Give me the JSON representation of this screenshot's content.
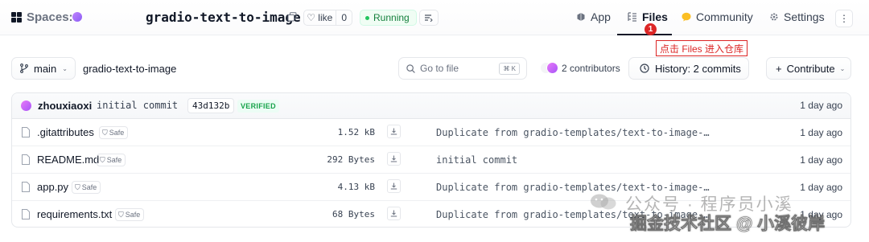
{
  "header": {
    "brand": "Spaces:",
    "repo_name": "gradio-text-to-image",
    "like_label": "like",
    "like_count": "0",
    "status": "Running",
    "nav": {
      "app": "App",
      "files": "Files",
      "community": "Community",
      "settings": "Settings"
    },
    "icons": [
      "spaces-logo-icon",
      "copy-icon",
      "heart-icon",
      "logs-icon",
      "app-icon",
      "files-icon",
      "community-icon",
      "gear-icon",
      "more-icon"
    ]
  },
  "annotation": {
    "number": "1",
    "callout": "点击 Files 进入仓库"
  },
  "toolbar": {
    "branch": "main",
    "path": "gradio-text-to-image",
    "search_placeholder": "Go to file",
    "search_shortcut": "⌘ K",
    "contributors": "2 contributors",
    "history": "History: 2 commits",
    "contribute": "Contribute"
  },
  "last_commit": {
    "author": "zhouxiaoxi",
    "message": "initial commit",
    "hash": "43d132b",
    "verified": "VERIFIED",
    "time": "1 day ago"
  },
  "files": [
    {
      "name": ".gitattributes",
      "safe": "Safe",
      "size": "1.52 kB",
      "commit": "Duplicate from gradio-templates/text-to-image-…",
      "time": "1 day ago"
    },
    {
      "name": "README.md",
      "safe": "Safe",
      "size": "292 Bytes",
      "commit": "initial commit",
      "time": "1 day ago"
    },
    {
      "name": "app.py",
      "safe": "Safe",
      "size": "4.13 kB",
      "commit": "Duplicate from gradio-templates/text-to-image-…",
      "time": "1 day ago"
    },
    {
      "name": "requirements.txt",
      "safe": "Safe",
      "size": "68 Bytes",
      "commit": "Duplicate from gradio-templates/text-to-image-…",
      "time": "1 day ago"
    }
  ],
  "watermark": {
    "line1": "公众号 · 程序员小溪",
    "line2": "掘金技术社区 @ 小溪彼岸"
  },
  "colors": {
    "accent_red": "#dc2626",
    "running_green": "#16a34a",
    "text_primary": "#111827",
    "border": "#e5e7eb"
  }
}
